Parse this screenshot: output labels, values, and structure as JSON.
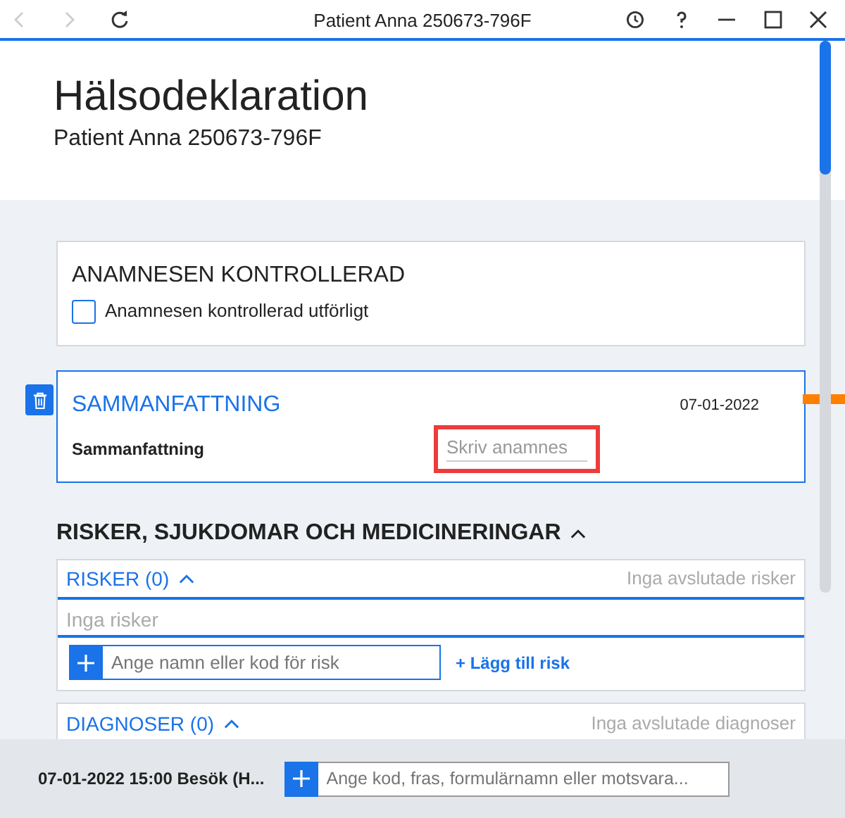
{
  "window": {
    "title": "Patient Anna 250673-796F"
  },
  "header": {
    "title": "Hälsodeklaration",
    "subtitle": "Patient Anna 250673-796F"
  },
  "anamnes_check": {
    "heading": "ANAMNESEN KONTROLLERAD",
    "label": "Anamnesen kontrollerad utförligt",
    "checked": false
  },
  "summary": {
    "heading": "SAMMANFATTNING",
    "date": "07-01-2022",
    "label": "Sammanfattning",
    "placeholder": "Skriv anamnes",
    "highlighted": true
  },
  "risks_section": {
    "heading": "RISKER, SJUKDOMAR OCH MEDICINERINGAR",
    "expanded": true
  },
  "panels": [
    {
      "heading": "RISKER (0)",
      "expanded": true,
      "note": "Inga avslutade risker",
      "empty_text": "Inga risker",
      "placeholder": "Ange namn eller kod för risk",
      "add_link": "+ Lägg till risk"
    },
    {
      "heading": "DIAGNOSER (0)",
      "expanded": true,
      "note": "Inga avslutade diagnoser"
    }
  ],
  "footer": {
    "visit": "07-01-2022 15:00 Besök (H...",
    "placeholder": "Ange kod, fras, formulärnamn eller motsvara..."
  }
}
